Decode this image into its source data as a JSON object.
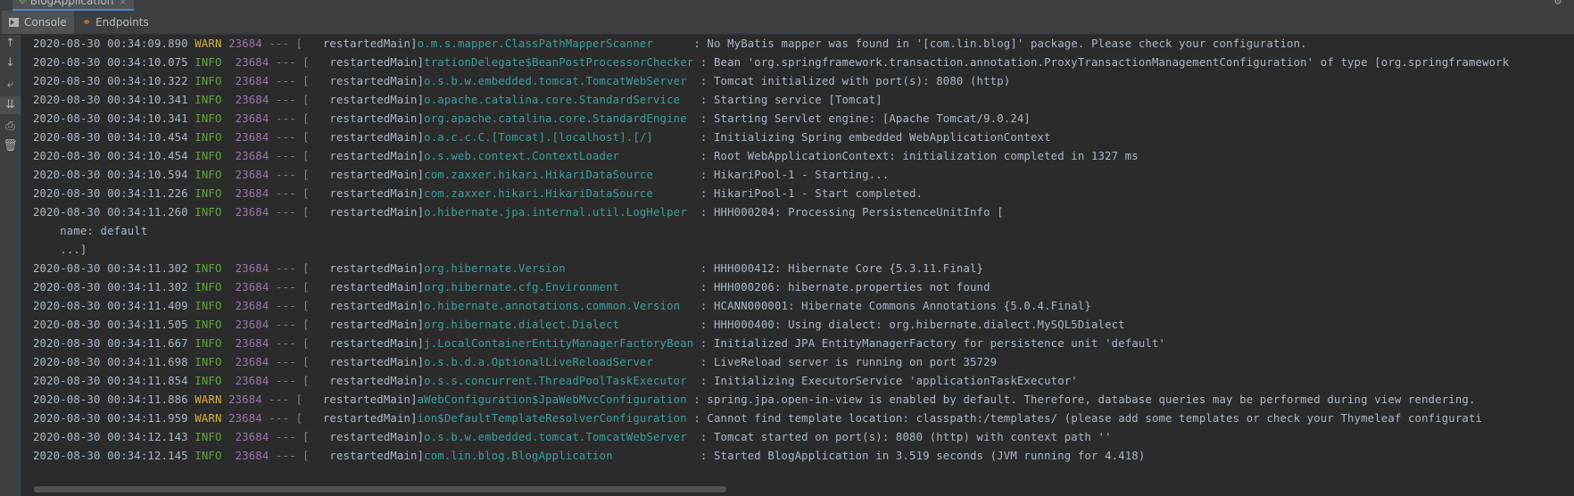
{
  "run_tab": {
    "label": "BlogApplication",
    "close": "×"
  },
  "tabs": [
    {
      "label": "Console"
    },
    {
      "label": "Endpoints"
    }
  ],
  "sidebar": {
    "icons": [
      "up-arrow-icon",
      "down-arrow-icon",
      "soft-wrap-icon",
      "scroll-to-end-icon",
      "print-icon",
      "clear-all-icon"
    ]
  },
  "log": [
    {
      "ts": "2020-08-30 00:34:09.890",
      "level": "WARN",
      "pid": "23684",
      "sep": "--- [",
      "thread": "  restartedMain]",
      "logger": "o.m.s.mapper.ClassPathMapperScanner     ",
      "msg": ": No MyBatis mapper was found in '[com.lin.blog]' package. Please check your configuration."
    },
    {
      "ts": "2020-08-30 00:34:10.075",
      "level": "INFO",
      "pid": "23684",
      "sep": "--- [",
      "thread": "  restartedMain]",
      "logger": "trationDelegate$BeanPostProcessorChecker",
      "msg": ": Bean 'org.springframework.transaction.annotation.ProxyTransactionManagementConfiguration' of type [org.springframework"
    },
    {
      "ts": "2020-08-30 00:34:10.322",
      "level": "INFO",
      "pid": "23684",
      "sep": "--- [",
      "thread": "  restartedMain]",
      "logger": "o.s.b.w.embedded.tomcat.TomcatWebServer ",
      "msg": ": Tomcat initialized with port(s): 8080 (http)"
    },
    {
      "ts": "2020-08-30 00:34:10.341",
      "level": "INFO",
      "pid": "23684",
      "sep": "--- [",
      "thread": "  restartedMain]",
      "logger": "o.apache.catalina.core.StandardService  ",
      "msg": ": Starting service [Tomcat]"
    },
    {
      "ts": "2020-08-30 00:34:10.341",
      "level": "INFO",
      "pid": "23684",
      "sep": "--- [",
      "thread": "  restartedMain]",
      "logger": "org.apache.catalina.core.StandardEngine ",
      "msg": ": Starting Servlet engine: [Apache Tomcat/9.0.24]"
    },
    {
      "ts": "2020-08-30 00:34:10.454",
      "level": "INFO",
      "pid": "23684",
      "sep": "--- [",
      "thread": "  restartedMain]",
      "logger": "o.a.c.c.C.[Tomcat].[localhost].[/]      ",
      "msg": ": Initializing Spring embedded WebApplicationContext"
    },
    {
      "ts": "2020-08-30 00:34:10.454",
      "level": "INFO",
      "pid": "23684",
      "sep": "--- [",
      "thread": "  restartedMain]",
      "logger": "o.s.web.context.ContextLoader           ",
      "msg": ": Root WebApplicationContext: initialization completed in 1327 ms"
    },
    {
      "ts": "2020-08-30 00:34:10.594",
      "level": "INFO",
      "pid": "23684",
      "sep": "--- [",
      "thread": "  restartedMain]",
      "logger": "com.zaxxer.hikari.HikariDataSource      ",
      "msg": ": HikariPool-1 - Starting..."
    },
    {
      "ts": "2020-08-30 00:34:11.226",
      "level": "INFO",
      "pid": "23684",
      "sep": "--- [",
      "thread": "  restartedMain]",
      "logger": "com.zaxxer.hikari.HikariDataSource      ",
      "msg": ": HikariPool-1 - Start completed."
    },
    {
      "ts": "2020-08-30 00:34:11.260",
      "level": "INFO",
      "pid": "23684",
      "sep": "--- [",
      "thread": "  restartedMain]",
      "logger": "o.hibernate.jpa.internal.util.LogHelper ",
      "msg": ": HHH000204: Processing PersistenceUnitInfo ["
    },
    {
      "text": "    name: default"
    },
    {
      "text": "    ...]"
    },
    {
      "ts": "2020-08-30 00:34:11.302",
      "level": "INFO",
      "pid": "23684",
      "sep": "--- [",
      "thread": "  restartedMain]",
      "logger": "org.hibernate.Version                   ",
      "msg": ": HHH000412: Hibernate Core {5.3.11.Final}"
    },
    {
      "ts": "2020-08-30 00:34:11.302",
      "level": "INFO",
      "pid": "23684",
      "sep": "--- [",
      "thread": "  restartedMain]",
      "logger": "org.hibernate.cfg.Environment           ",
      "msg": ": HHH000206: hibernate.properties not found"
    },
    {
      "ts": "2020-08-30 00:34:11.409",
      "level": "INFO",
      "pid": "23684",
      "sep": "--- [",
      "thread": "  restartedMain]",
      "logger": "o.hibernate.annotations.common.Version  ",
      "msg": ": HCANN000001: Hibernate Commons Annotations {5.0.4.Final}"
    },
    {
      "ts": "2020-08-30 00:34:11.505",
      "level": "INFO",
      "pid": "23684",
      "sep": "--- [",
      "thread": "  restartedMain]",
      "logger": "org.hibernate.dialect.Dialect           ",
      "msg": ": HHH000400: Using dialect: org.hibernate.dialect.MySQL5Dialect"
    },
    {
      "ts": "2020-08-30 00:34:11.667",
      "level": "INFO",
      "pid": "23684",
      "sep": "--- [",
      "thread": "  restartedMain]",
      "logger": "j.LocalContainerEntityManagerFactoryBean",
      "msg": ": Initialized JPA EntityManagerFactory for persistence unit 'default'"
    },
    {
      "ts": "2020-08-30 00:34:11.698",
      "level": "INFO",
      "pid": "23684",
      "sep": "--- [",
      "thread": "  restartedMain]",
      "logger": "o.s.b.d.a.OptionalLiveReloadServer      ",
      "msg": ": LiveReload server is running on port 35729"
    },
    {
      "ts": "2020-08-30 00:34:11.854",
      "level": "INFO",
      "pid": "23684",
      "sep": "--- [",
      "thread": "  restartedMain]",
      "logger": "o.s.s.concurrent.ThreadPoolTaskExecutor ",
      "msg": ": Initializing ExecutorService 'applicationTaskExecutor'"
    },
    {
      "ts": "2020-08-30 00:34:11.886",
      "level": "WARN",
      "pid": "23684",
      "sep": "--- [",
      "thread": "  restartedMain]",
      "logger": "aWebConfiguration$JpaWebMvcConfiguration",
      "msg": ": spring.jpa.open-in-view is enabled by default. Therefore, database queries may be performed during view rendering."
    },
    {
      "ts": "2020-08-30 00:34:11.959",
      "level": "WARN",
      "pid": "23684",
      "sep": "--- [",
      "thread": "  restartedMain]",
      "logger": "ion$DefaultTemplateResolverConfiguration",
      "msg": ": Cannot find template location: classpath:/templates/ (please add some templates or check your Thymeleaf configurati"
    },
    {
      "ts": "2020-08-30 00:34:12.143",
      "level": "INFO",
      "pid": "23684",
      "sep": "--- [",
      "thread": "  restartedMain]",
      "logger": "o.s.b.w.embedded.tomcat.TomcatWebServer ",
      "msg": ": Tomcat started on port(s): 8080 (http) with context path ''"
    },
    {
      "ts": "2020-08-30 00:34:12.145",
      "level": "INFO",
      "pid": "23684",
      "sep": "--- [",
      "thread": "  restartedMain]",
      "logger": "com.lin.blog.BlogApplication            ",
      "msg": ": Started BlogApplication in 3.519 seconds (JVM running for 4.418)"
    }
  ],
  "colors": {
    "background": "#2b2b2b",
    "info": "#62a33f",
    "warn": "#d0b344",
    "pid": "#9876aa",
    "logger": "#3e9e99",
    "text": "#a9b7c6"
  }
}
